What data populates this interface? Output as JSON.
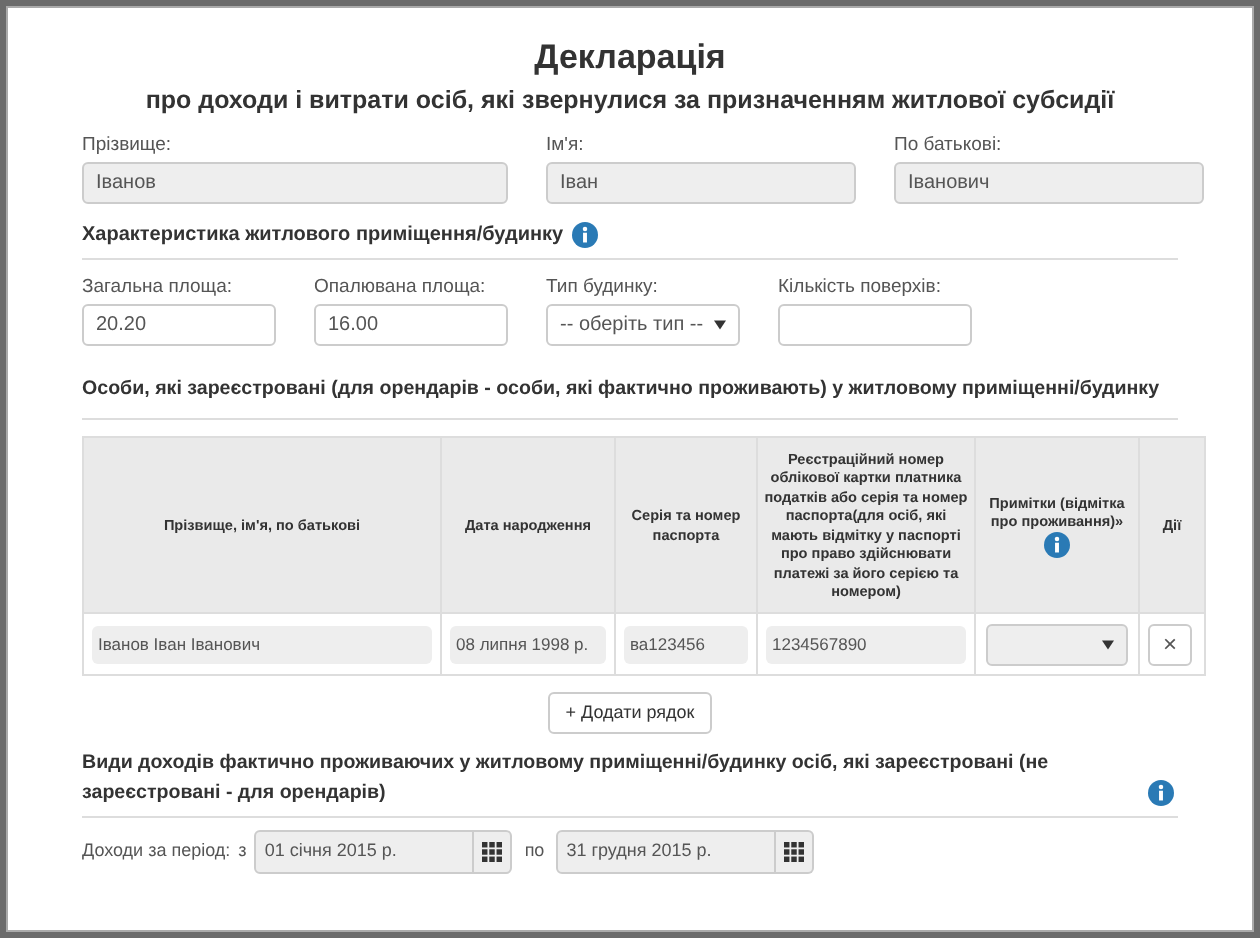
{
  "title": "Декларація",
  "subtitle": "про доходи і витрати осіб, які звернулися за призначенням житлової субсидії",
  "name_fields": [
    {
      "label": "Прізвище:",
      "value": "Іванов",
      "disabled": true
    },
    {
      "label": "Ім'я:",
      "value": "Іван",
      "disabled": true
    },
    {
      "label": "По батькові:",
      "value": "Іванович",
      "disabled": true
    }
  ],
  "housing": {
    "heading": "Характеристика житлового приміщення/будинку",
    "fields": [
      {
        "kind": "input",
        "label": "Загальна площа:",
        "value": "20.20"
      },
      {
        "kind": "input",
        "label": "Опалювана площа:",
        "value": "16.00"
      },
      {
        "kind": "select",
        "label": "Тип будинку:",
        "value": "-- оберіть тип --"
      },
      {
        "kind": "input",
        "label": "Кількість поверхів:"
      }
    ]
  },
  "persons": {
    "heading": "Особи, які зареєстровані (для орендарів - особи, які фактично проживають) у житловому приміщенні/будинку",
    "columns": [
      {
        "label": "Прізвище, ім'я, по батькові",
        "info": false
      },
      {
        "label": "Дата народження",
        "info": false
      },
      {
        "label": "Серія та номер паспорта",
        "info": false
      },
      {
        "label": "Реєстраційний номер облікової картки платника податків або серія та номер паспорта(для осіб, які мають відмітку у паспорті про право здійснювати платежі за його серією та номером)",
        "info": false
      },
      {
        "label": "Примітки (відмітка про проживання)»",
        "info": true
      },
      {
        "label": "Дії",
        "info": false
      }
    ],
    "rows": [
      {
        "name": "Іванов Іван Іванович",
        "birth_date": "08 липня 1998 р.",
        "passport": "ва123456",
        "tax_number": "1234567890",
        "note_disabled": true,
        "delete": "×"
      }
    ],
    "add_button": "+ Додати рядок"
  },
  "income": {
    "heading": "Види доходів фактично проживаючих у житловому приміщенні/будинку осіб, які зареєстровані (не зареєстровані - для орендарів)",
    "period_label": "Доходи за період:",
    "from_label": "з",
    "from": "01 січня 2015 р.",
    "to_label": "по",
    "to": "31 грудня 2015 р."
  }
}
